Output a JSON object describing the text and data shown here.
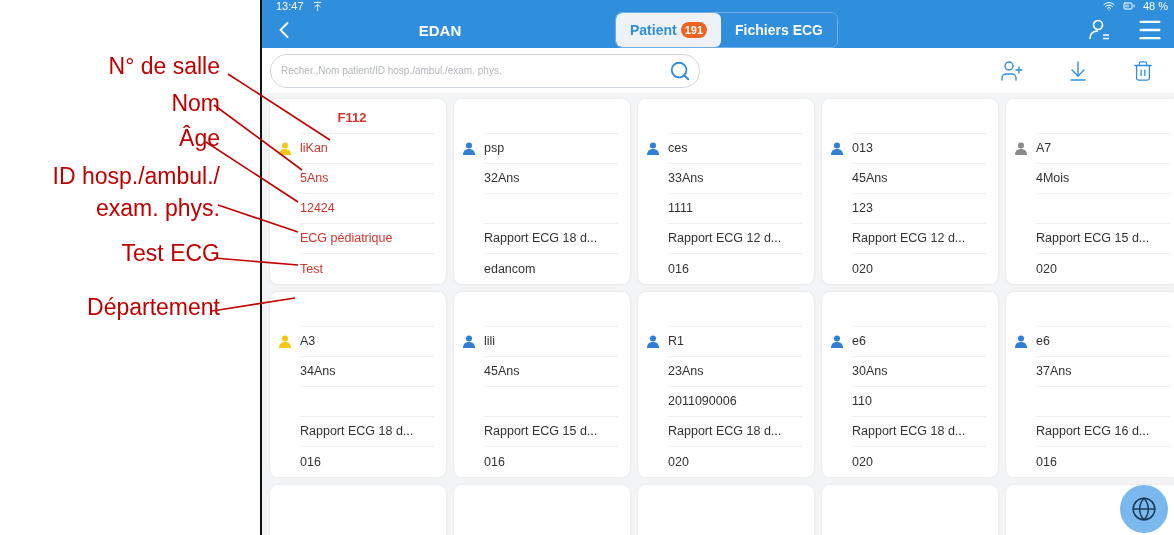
{
  "annotations": [
    {
      "text": "N° de salle"
    },
    {
      "text": "Nom"
    },
    {
      "text": "Âge"
    },
    {
      "text": "ID hosp./ambul./\nexam. phys."
    },
    {
      "text": "Test ECG"
    },
    {
      "text": "Département"
    }
  ],
  "status_bar": {
    "time": "13:47",
    "battery": "48 %"
  },
  "header": {
    "title": "EDAN",
    "tabs": [
      {
        "label": "Patient",
        "badge": "191",
        "selected": true
      },
      {
        "label": "Fichiers ECG",
        "selected": false
      }
    ]
  },
  "search": {
    "placeholder": "Recher.,Nom patient/ID hosp./ambul./exam. phys."
  },
  "cards": [
    {
      "highlighted": true,
      "color": "#f2c811",
      "room": "F112",
      "name": "liKan",
      "age": "5Ans",
      "id": "12424",
      "test": "ECG pédiatrique",
      "department": "Test"
    },
    {
      "highlighted": false,
      "color": "#2f7fd4",
      "name": "psp",
      "age": "32Ans",
      "test": "Rapport ECG 18 d...",
      "department": "edancom"
    },
    {
      "highlighted": false,
      "color": "#2f7fd4",
      "name": "ces",
      "age": "33Ans",
      "id": "1111",
      "test": "Rapport ECG 12 d...",
      "department": "016"
    },
    {
      "highlighted": false,
      "color": "#2f7fd4",
      "name": "013",
      "age": "45Ans",
      "id": "123",
      "test": "Rapport ECG 12 d...",
      "department": "020"
    },
    {
      "highlighted": false,
      "color": "#8a8a8a",
      "name": "A7",
      "age": "4Mois",
      "test": "Rapport ECG 15 d...",
      "department": "020"
    },
    {
      "highlighted": false,
      "color": "#f2c811",
      "name": "A3",
      "age": "34Ans",
      "test": "Rapport ECG 18 d...",
      "department": "016"
    },
    {
      "highlighted": false,
      "color": "#2f7fd4",
      "name": "lili",
      "age": "45Ans",
      "test": "Rapport ECG 15 d...",
      "department": "016"
    },
    {
      "highlighted": false,
      "color": "#2f7fd4",
      "name": "R1",
      "age": "23Ans",
      "id": "2011090006",
      "test": "Rapport ECG 18 d...",
      "department": "020"
    },
    {
      "highlighted": false,
      "color": "#2f7fd4",
      "name": "e6",
      "age": "30Ans",
      "id": "110",
      "test": "Rapport ECG 18 d...",
      "department": "020"
    },
    {
      "highlighted": false,
      "color": "#2f7fd4",
      "name": "e6",
      "age": "37Ans",
      "test": "Rapport ECG 16 d...",
      "department": "016"
    }
  ]
}
